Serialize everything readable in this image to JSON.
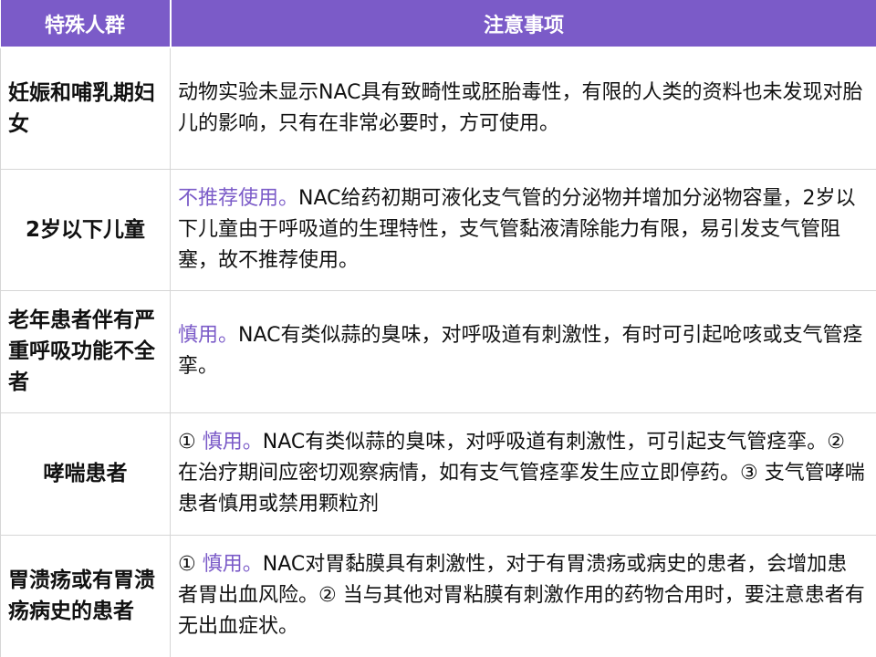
{
  "header": {
    "col_group": "特殊人群",
    "col_notes": "注意事项"
  },
  "rows": [
    {
      "group": "妊娠和哺乳期妇女",
      "highlight": "",
      "text": "动物实验未显示NAC具有致畸性或胚胎毒性，有限的人类的资料也未发现对胎儿的影响，只有在非常必要时，方可使用。"
    },
    {
      "group": "2岁以下儿童",
      "highlight": "不推荐使用。",
      "text": "NAC给药初期可液化支气管的分泌物并增加分泌物容量，2岁以下儿童由于呼吸道的生理特性，支气管黏液清除能力有限，易引发支气管阻塞，故不推荐使用。"
    },
    {
      "group": "老年患者伴有严重呼吸功能不全者",
      "highlight": "慎用。",
      "text": "NAC有类似蒜的臭味，对呼吸道有刺激性，有时可引起呛咳或支气管痉挛。"
    },
    {
      "group": "哮喘患者",
      "prefix": "① ",
      "highlight": "慎用。",
      "text": "NAC有类似蒜的臭味，对呼吸道有刺激性，可引起支气管痉挛。② 在治疗期间应密切观察病情，如有支气管痉挛发生应立即停药。③ 支气管哮喘患者慎用或禁用颗粒剂"
    },
    {
      "group": "胃溃疡或有胃溃疡病史的患者",
      "prefix": "① ",
      "highlight": "慎用。",
      "text": "NAC对胃黏膜具有刺激性，对于有胃溃疡或病史的患者，会增加患者胃出血风险。② 当与其他对胃粘膜有刺激作用的药物合用时，要注意患者有无出血症状。"
    }
  ],
  "colors": {
    "header_bg": "#7b5bc8",
    "highlight": "#7b5bc8",
    "border": "#d6d6d6"
  }
}
